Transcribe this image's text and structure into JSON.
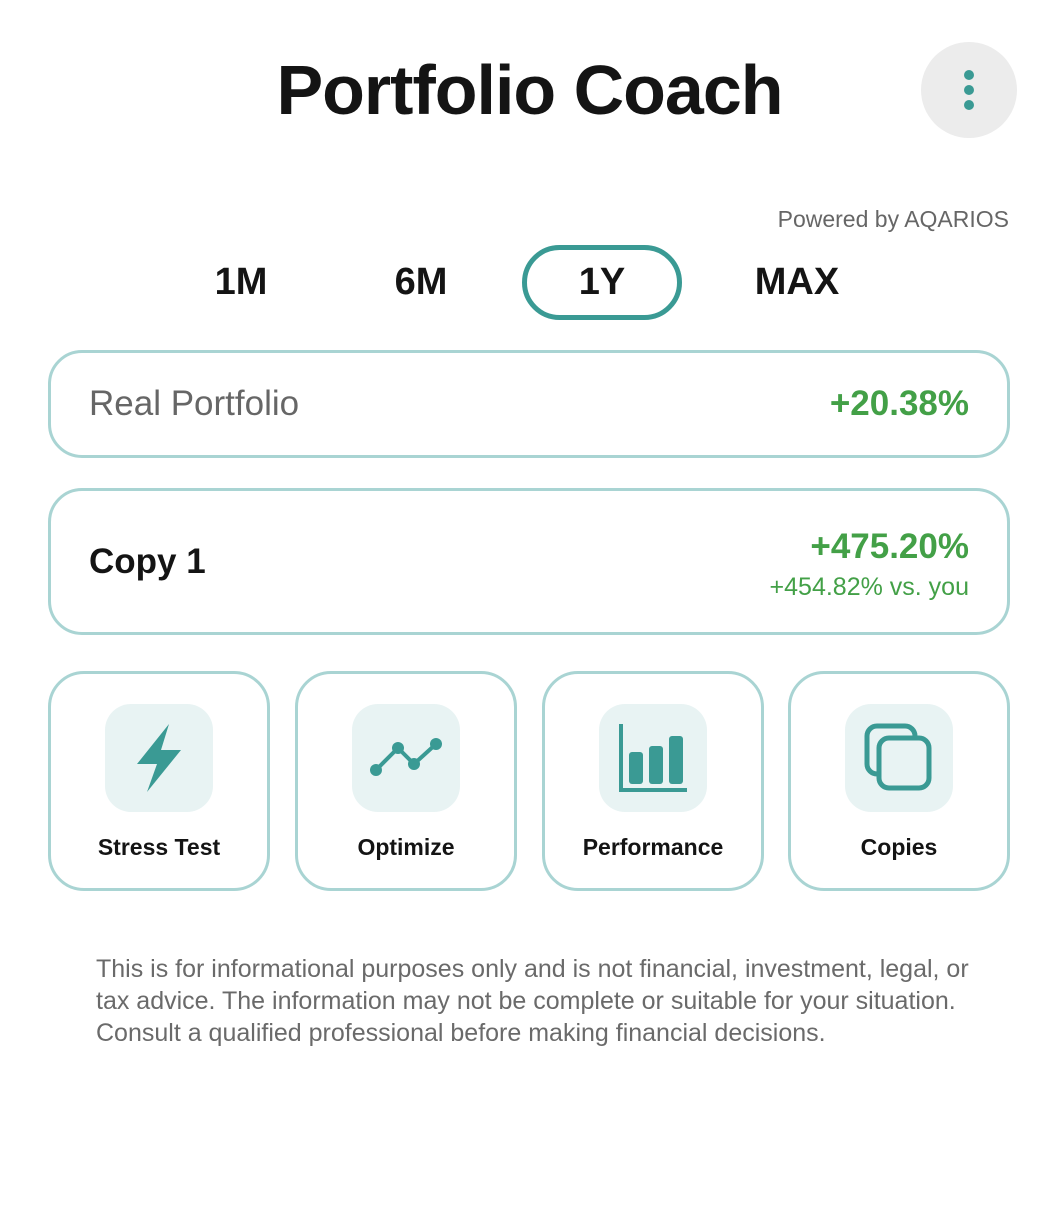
{
  "header": {
    "title": "Portfolio Coach",
    "menu_icon": "kebab-menu-icon"
  },
  "powered_by": "Powered by AQARIOS",
  "periods": {
    "items": [
      "1M",
      "6M",
      "1Y",
      "MAX"
    ],
    "selected": "1Y"
  },
  "real_portfolio": {
    "label": "Real Portfolio",
    "value": "+20.38%"
  },
  "copy_1": {
    "label": "Copy 1",
    "value": "+475.20%",
    "comparison": "+454.82% vs. you"
  },
  "actions": [
    {
      "label": "Stress Test",
      "icon": "lightning-icon"
    },
    {
      "label": "Optimize",
      "icon": "trend-line-icon"
    },
    {
      "label": "Performance",
      "icon": "bar-chart-icon"
    },
    {
      "label": "Copies",
      "icon": "copies-icon"
    }
  ],
  "disclaimer": "This is for informational purposes only and is not financial, investment, legal, or tax advice. The information may not be complete or suitable for your situation. Consult a qualified professional before making financial decisions.",
  "colors": {
    "accent": "#3a9a94",
    "positive": "#43a047",
    "card_border": "#a9d4d3",
    "icon_bg": "#e8f3f3",
    "menu_bg": "#ececec"
  }
}
